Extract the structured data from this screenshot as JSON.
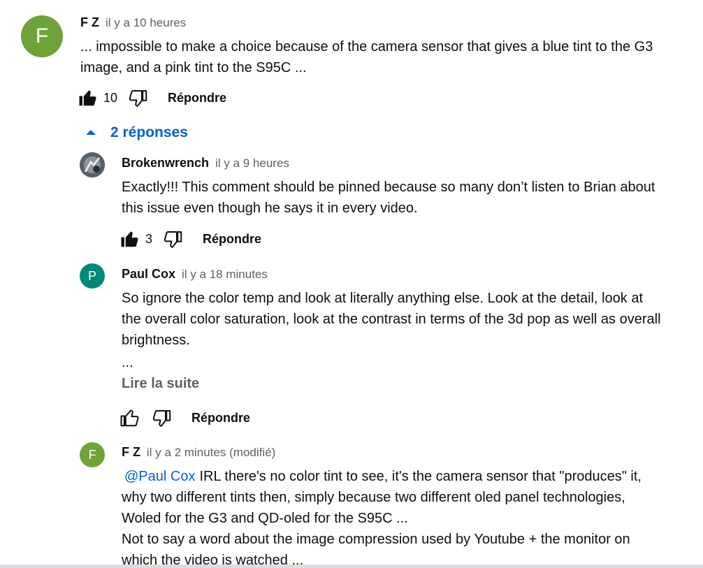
{
  "comments": [
    {
      "avatar_letter": "F",
      "author": "F Z",
      "time": "il y a 10 heures",
      "text_lines": [
        "... impossible to make a choice because of the camera sensor that gives a blue tint to the G3",
        "image, and a pink tint to the S95C ..."
      ],
      "likes": "10",
      "reply_label": "Répondre",
      "replies_toggle": "2 réponses"
    }
  ],
  "replies": [
    {
      "author": "Brokenwrench",
      "time": "il y a 9 heures",
      "text_lines": [
        "Exactly!!! This comment should be pinned because so many don’t listen to Brian about",
        "this issue even though he says it in every video."
      ],
      "likes": "3",
      "reply_label": "Répondre"
    },
    {
      "avatar_letter": "P",
      "author": "Paul Cox",
      "time": "il y a 18 minutes",
      "text_lines": [
        "So ignore the color temp and look at literally anything else.  Look at the detail, look at",
        "the overall color saturation, look at the contrast in terms of the 3d pop as well as overall",
        "brightness."
      ],
      "ellipsis": "...",
      "read_more": "Lire la suite",
      "reply_label": "Répondre"
    },
    {
      "avatar_letter": "F",
      "author": "F Z",
      "time": "il y a 2 minutes (modifié)",
      "mention": "@Paul Cox",
      "text_first": "IRL there's no color tint to see, it's the camera sensor that \"produces\" it,",
      "text_lines": [
        "why two different tints then, simply because two different oled panel technologies,",
        "Woled for the G3 and QD-oled for the S95C ...",
        "Not to say a word about the image compression used by Youtube + the monitor on",
        "which the video is watched ..."
      ]
    }
  ],
  "colors": {
    "avatar_f": "#6fa33a",
    "avatar_p": "#00897b",
    "link_blue": "#065fd4",
    "meta_gray": "#606060"
  },
  "icons": {
    "like_filled": "thumbs-up-filled-icon",
    "like_outline": "thumbs-up-outline-icon",
    "dislike_outline": "thumbs-down-outline-icon",
    "caret_up": "caret-up-icon"
  }
}
